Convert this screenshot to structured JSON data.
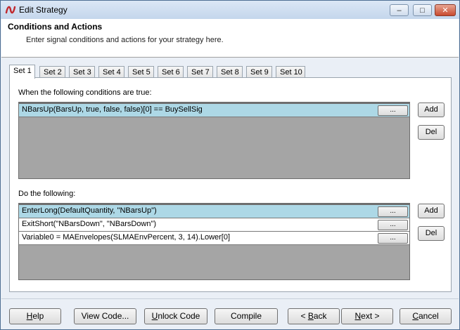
{
  "window": {
    "title": "Edit Strategy"
  },
  "header": {
    "title": "Conditions and Actions",
    "subtitle": "Enter signal conditions and actions for your strategy here."
  },
  "tabs": [
    "Set 1",
    "Set 2",
    "Set 3",
    "Set 4",
    "Set 5",
    "Set 6",
    "Set 7",
    "Set 8",
    "Set 9",
    "Set 10"
  ],
  "active_tab": "Set 1",
  "conditions": {
    "label": "When the following conditions are true:",
    "rows": [
      {
        "text": "NBarsUp(BarsUp, true, false, false)[0] == BuySellSig",
        "button": "...",
        "selected": true
      }
    ],
    "add_label": "Add",
    "del_label": "Del"
  },
  "actions": {
    "label": "Do the following:",
    "rows": [
      {
        "text": "EnterLong(DefaultQuantity, \"NBarsUp\")",
        "button": "...",
        "selected": true
      },
      {
        "text": "ExitShort(\"NBarsDown\", \"NBarsDown\")",
        "button": "...",
        "selected": false
      },
      {
        "text": "Variable0 = MAEnvelopes(SLMAEnvPercent, 3, 14).Lower[0]",
        "button": "...",
        "selected": false
      }
    ],
    "add_label": "Add",
    "del_label": "Del"
  },
  "footer": {
    "help": {
      "mnemonic": "H",
      "rest": "elp"
    },
    "view_code": "View Code...",
    "unlock_code": {
      "mnemonic": "U",
      "rest": "nlock Code"
    },
    "compile": "Compile",
    "back": {
      "pre": "< ",
      "mnemonic": "B",
      "rest": "ack"
    },
    "next": {
      "mnemonic": "N",
      "rest": "ext >"
    },
    "cancel": {
      "mnemonic": "C",
      "rest": "ancel"
    }
  },
  "caption_buttons": {
    "minimize": "–",
    "maximize": "□",
    "close": "✕"
  }
}
